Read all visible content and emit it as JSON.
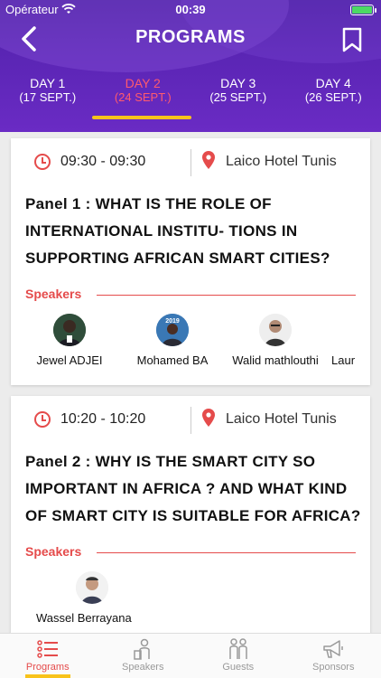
{
  "status_bar": {
    "carrier": "Opérateur",
    "time": "00:39"
  },
  "header": {
    "title": "PROGRAMS"
  },
  "tabs": [
    {
      "label": "DAY 1",
      "date": "(17 SEPT.)",
      "active": false
    },
    {
      "label": "DAY 2",
      "date": "(24 SEPT.)",
      "active": true
    },
    {
      "label": "DAY 3",
      "date": "(25 SEPT.)",
      "active": false
    },
    {
      "label": "DAY 4",
      "date": "(26 SEPT.)",
      "active": false
    }
  ],
  "sessions": [
    {
      "time": "09:30 - 09:30",
      "location": "Laico Hotel Tunis",
      "title": "Panel 1 :  WHAT IS THE ROLE OF INTERNATIONAL INSTITU- TIONS IN SUPPORTING AFRICAN SMART CITIES?",
      "speakers_label": "Speakers",
      "speakers": [
        "Jewel ADJEI",
        "Mohamed BA",
        "Walid mathlouthi",
        "Laur"
      ]
    },
    {
      "time": "10:20 - 10:20",
      "location": "Laico Hotel Tunis",
      "title": "Panel 2 : WHY IS THE SMART CITY SO IMPORTANT IN AFRICA ? AND WHAT KIND OF SMART CITY IS SUITABLE FOR AFRICA?",
      "speakers_label": "Speakers",
      "speakers": [
        "Wassel Berrayana"
      ]
    }
  ],
  "avatar_badge": "2019",
  "bottom_nav": [
    {
      "label": "Programs",
      "icon": "list-icon",
      "active": true
    },
    {
      "label": "Speakers",
      "icon": "speaker-icon",
      "active": false
    },
    {
      "label": "Guests",
      "icon": "guests-icon",
      "active": false
    },
    {
      "label": "Sponsors",
      "icon": "megaphone-icon",
      "active": false
    }
  ],
  "colors": {
    "header": "#5a25b4",
    "accent": "#e54b4b",
    "active_tab": "#ff5a6e",
    "underline": "#f8c31b"
  }
}
